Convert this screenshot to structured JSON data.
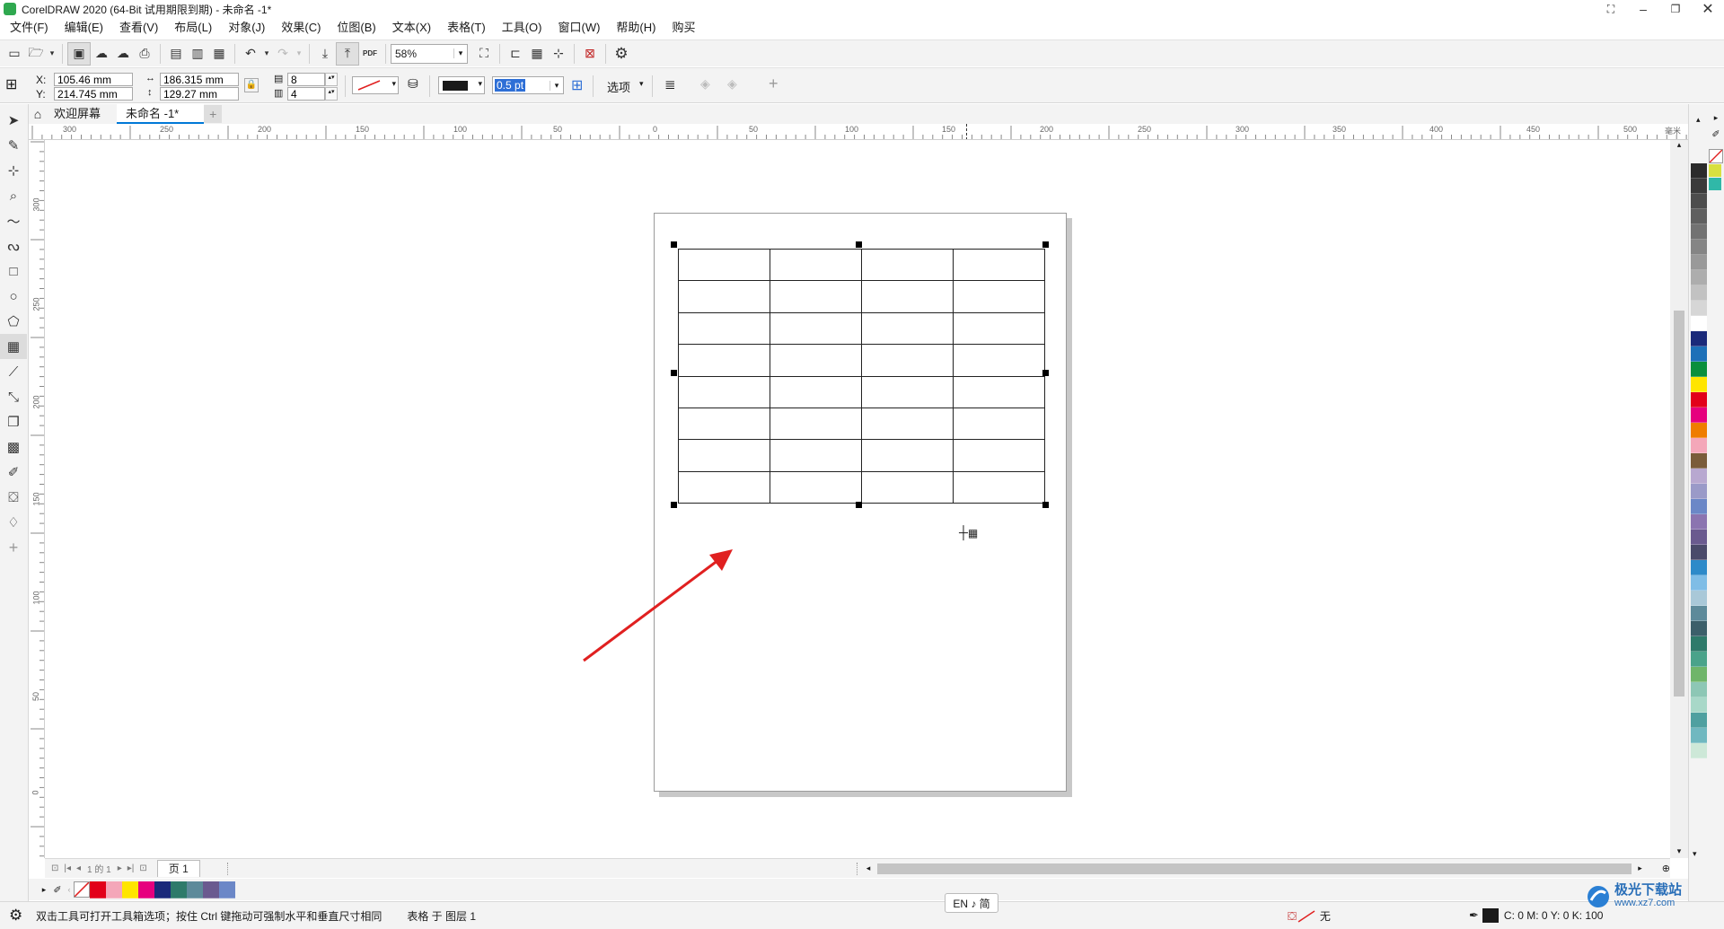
{
  "title_bar": {
    "title": "CorelDRAW 2020 (64-Bit 试用期限到期) - 未命名 -1*"
  },
  "menu": [
    "文件(F)",
    "编辑(E)",
    "查看(V)",
    "布局(L)",
    "对象(J)",
    "效果(C)",
    "位图(B)",
    "文本(X)",
    "表格(T)",
    "工具(O)",
    "窗口(W)",
    "帮助(H)",
    "购买"
  ],
  "toolbar": {
    "zoom": "58%",
    "pdf_label": "PDF"
  },
  "property_bar": {
    "x_label": "X:",
    "y_label": "Y:",
    "x_value": "105.46 mm",
    "y_value": "214.745 mm",
    "width_value": "186.315 mm",
    "height_value": "129.27 mm",
    "rows": "8",
    "cols": "4",
    "outline_width": "0.5 pt",
    "options_label": "选项"
  },
  "tabs": {
    "welcome": "欢迎屏幕",
    "document": "未命名 -1*",
    "add": "+"
  },
  "ruler": {
    "h_labels": [
      "300",
      "250",
      "200",
      "150",
      "100",
      "50",
      "0",
      "50",
      "100",
      "150",
      "200",
      "250",
      "300",
      "350",
      "400",
      "450",
      "500"
    ],
    "h_unit": "毫米",
    "v_labels": [
      "300",
      "250",
      "200",
      "150",
      "100",
      "50",
      "0"
    ]
  },
  "table": {
    "rows": 8,
    "cols": 4
  },
  "page_nav": {
    "page_count": "1 的 1",
    "page_tab": "页 1"
  },
  "palette_colors": [
    "#2b2b2b",
    "#3a3a3a",
    "#4d4d4d",
    "#5f5f5f",
    "#727272",
    "#858585",
    "#999999",
    "#adadad",
    "#c2c2c2",
    "#d6d6d6",
    "#ffffff",
    "#1b2a7a",
    "#1d70b8",
    "#0a8f3c",
    "#ffe500",
    "#e2001a",
    "#e6007e",
    "#ef7d00",
    "#f4a7b9",
    "#7a5c3a",
    "#b8a8d0",
    "#9a9ac8",
    "#6b87c7",
    "#8b74b0",
    "#6a5a8f",
    "#4a4a6a",
    "#2d8ac9",
    "#7fbde6",
    "#a9c8d8",
    "#5d8a9a",
    "#3c5f6a",
    "#2e7a6a",
    "#4aa38a",
    "#6fb56a",
    "#8dc7b5",
    "#a8d8c8",
    "#4fa0a0",
    "#70b8c0",
    "#cde8d8"
  ],
  "bottom_palette": [
    "#e2001a",
    "#f4a7b9",
    "#ffe500",
    "#e6007e",
    "#1b2a7a",
    "#2e7a6a",
    "#5d8a9a",
    "#6a5a8f",
    "#6b87c7"
  ],
  "ime": {
    "label": "EN ♪ 简"
  },
  "status": {
    "hint": "双击工具可打开工具箱选项；按住 Ctrl 键拖动可强制水平和垂直尺寸相同",
    "object_info": "表格 于 图层 1",
    "fill_none": "无",
    "cmyk": "C: 0 M: 0 Y: 0 K: 100"
  },
  "watermark": {
    "name": "极光下载站",
    "url": "www.xz7.com"
  },
  "colors": {
    "accent_blue": "#0078d7",
    "arrow_red": "#e02020",
    "selection_blue": "#2e6fd6"
  }
}
